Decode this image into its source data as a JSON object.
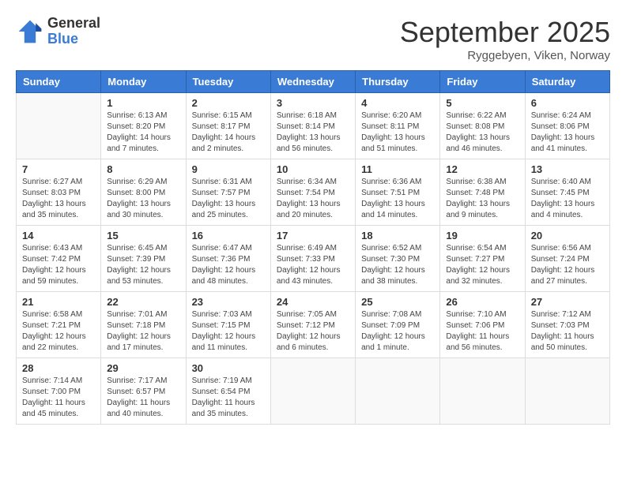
{
  "logo": {
    "general": "General",
    "blue": "Blue"
  },
  "header": {
    "month": "September 2025",
    "location": "Ryggebyen, Viken, Norway"
  },
  "weekdays": [
    "Sunday",
    "Monday",
    "Tuesday",
    "Wednesday",
    "Thursday",
    "Friday",
    "Saturday"
  ],
  "weeks": [
    [
      {
        "day": "",
        "sunrise": "",
        "sunset": "",
        "daylight": ""
      },
      {
        "day": "1",
        "sunrise": "Sunrise: 6:13 AM",
        "sunset": "Sunset: 8:20 PM",
        "daylight": "Daylight: 14 hours and 7 minutes."
      },
      {
        "day": "2",
        "sunrise": "Sunrise: 6:15 AM",
        "sunset": "Sunset: 8:17 PM",
        "daylight": "Daylight: 14 hours and 2 minutes."
      },
      {
        "day": "3",
        "sunrise": "Sunrise: 6:18 AM",
        "sunset": "Sunset: 8:14 PM",
        "daylight": "Daylight: 13 hours and 56 minutes."
      },
      {
        "day": "4",
        "sunrise": "Sunrise: 6:20 AM",
        "sunset": "Sunset: 8:11 PM",
        "daylight": "Daylight: 13 hours and 51 minutes."
      },
      {
        "day": "5",
        "sunrise": "Sunrise: 6:22 AM",
        "sunset": "Sunset: 8:08 PM",
        "daylight": "Daylight: 13 hours and 46 minutes."
      },
      {
        "day": "6",
        "sunrise": "Sunrise: 6:24 AM",
        "sunset": "Sunset: 8:06 PM",
        "daylight": "Daylight: 13 hours and 41 minutes."
      }
    ],
    [
      {
        "day": "7",
        "sunrise": "Sunrise: 6:27 AM",
        "sunset": "Sunset: 8:03 PM",
        "daylight": "Daylight: 13 hours and 35 minutes."
      },
      {
        "day": "8",
        "sunrise": "Sunrise: 6:29 AM",
        "sunset": "Sunset: 8:00 PM",
        "daylight": "Daylight: 13 hours and 30 minutes."
      },
      {
        "day": "9",
        "sunrise": "Sunrise: 6:31 AM",
        "sunset": "Sunset: 7:57 PM",
        "daylight": "Daylight: 13 hours and 25 minutes."
      },
      {
        "day": "10",
        "sunrise": "Sunrise: 6:34 AM",
        "sunset": "Sunset: 7:54 PM",
        "daylight": "Daylight: 13 hours and 20 minutes."
      },
      {
        "day": "11",
        "sunrise": "Sunrise: 6:36 AM",
        "sunset": "Sunset: 7:51 PM",
        "daylight": "Daylight: 13 hours and 14 minutes."
      },
      {
        "day": "12",
        "sunrise": "Sunrise: 6:38 AM",
        "sunset": "Sunset: 7:48 PM",
        "daylight": "Daylight: 13 hours and 9 minutes."
      },
      {
        "day": "13",
        "sunrise": "Sunrise: 6:40 AM",
        "sunset": "Sunset: 7:45 PM",
        "daylight": "Daylight: 13 hours and 4 minutes."
      }
    ],
    [
      {
        "day": "14",
        "sunrise": "Sunrise: 6:43 AM",
        "sunset": "Sunset: 7:42 PM",
        "daylight": "Daylight: 12 hours and 59 minutes."
      },
      {
        "day": "15",
        "sunrise": "Sunrise: 6:45 AM",
        "sunset": "Sunset: 7:39 PM",
        "daylight": "Daylight: 12 hours and 53 minutes."
      },
      {
        "day": "16",
        "sunrise": "Sunrise: 6:47 AM",
        "sunset": "Sunset: 7:36 PM",
        "daylight": "Daylight: 12 hours and 48 minutes."
      },
      {
        "day": "17",
        "sunrise": "Sunrise: 6:49 AM",
        "sunset": "Sunset: 7:33 PM",
        "daylight": "Daylight: 12 hours and 43 minutes."
      },
      {
        "day": "18",
        "sunrise": "Sunrise: 6:52 AM",
        "sunset": "Sunset: 7:30 PM",
        "daylight": "Daylight: 12 hours and 38 minutes."
      },
      {
        "day": "19",
        "sunrise": "Sunrise: 6:54 AM",
        "sunset": "Sunset: 7:27 PM",
        "daylight": "Daylight: 12 hours and 32 minutes."
      },
      {
        "day": "20",
        "sunrise": "Sunrise: 6:56 AM",
        "sunset": "Sunset: 7:24 PM",
        "daylight": "Daylight: 12 hours and 27 minutes."
      }
    ],
    [
      {
        "day": "21",
        "sunrise": "Sunrise: 6:58 AM",
        "sunset": "Sunset: 7:21 PM",
        "daylight": "Daylight: 12 hours and 22 minutes."
      },
      {
        "day": "22",
        "sunrise": "Sunrise: 7:01 AM",
        "sunset": "Sunset: 7:18 PM",
        "daylight": "Daylight: 12 hours and 17 minutes."
      },
      {
        "day": "23",
        "sunrise": "Sunrise: 7:03 AM",
        "sunset": "Sunset: 7:15 PM",
        "daylight": "Daylight: 12 hours and 11 minutes."
      },
      {
        "day": "24",
        "sunrise": "Sunrise: 7:05 AM",
        "sunset": "Sunset: 7:12 PM",
        "daylight": "Daylight: 12 hours and 6 minutes."
      },
      {
        "day": "25",
        "sunrise": "Sunrise: 7:08 AM",
        "sunset": "Sunset: 7:09 PM",
        "daylight": "Daylight: 12 hours and 1 minute."
      },
      {
        "day": "26",
        "sunrise": "Sunrise: 7:10 AM",
        "sunset": "Sunset: 7:06 PM",
        "daylight": "Daylight: 11 hours and 56 minutes."
      },
      {
        "day": "27",
        "sunrise": "Sunrise: 7:12 AM",
        "sunset": "Sunset: 7:03 PM",
        "daylight": "Daylight: 11 hours and 50 minutes."
      }
    ],
    [
      {
        "day": "28",
        "sunrise": "Sunrise: 7:14 AM",
        "sunset": "Sunset: 7:00 PM",
        "daylight": "Daylight: 11 hours and 45 minutes."
      },
      {
        "day": "29",
        "sunrise": "Sunrise: 7:17 AM",
        "sunset": "Sunset: 6:57 PM",
        "daylight": "Daylight: 11 hours and 40 minutes."
      },
      {
        "day": "30",
        "sunrise": "Sunrise: 7:19 AM",
        "sunset": "Sunset: 6:54 PM",
        "daylight": "Daylight: 11 hours and 35 minutes."
      },
      {
        "day": "",
        "sunrise": "",
        "sunset": "",
        "daylight": ""
      },
      {
        "day": "",
        "sunrise": "",
        "sunset": "",
        "daylight": ""
      },
      {
        "day": "",
        "sunrise": "",
        "sunset": "",
        "daylight": ""
      },
      {
        "day": "",
        "sunrise": "",
        "sunset": "",
        "daylight": ""
      }
    ]
  ]
}
